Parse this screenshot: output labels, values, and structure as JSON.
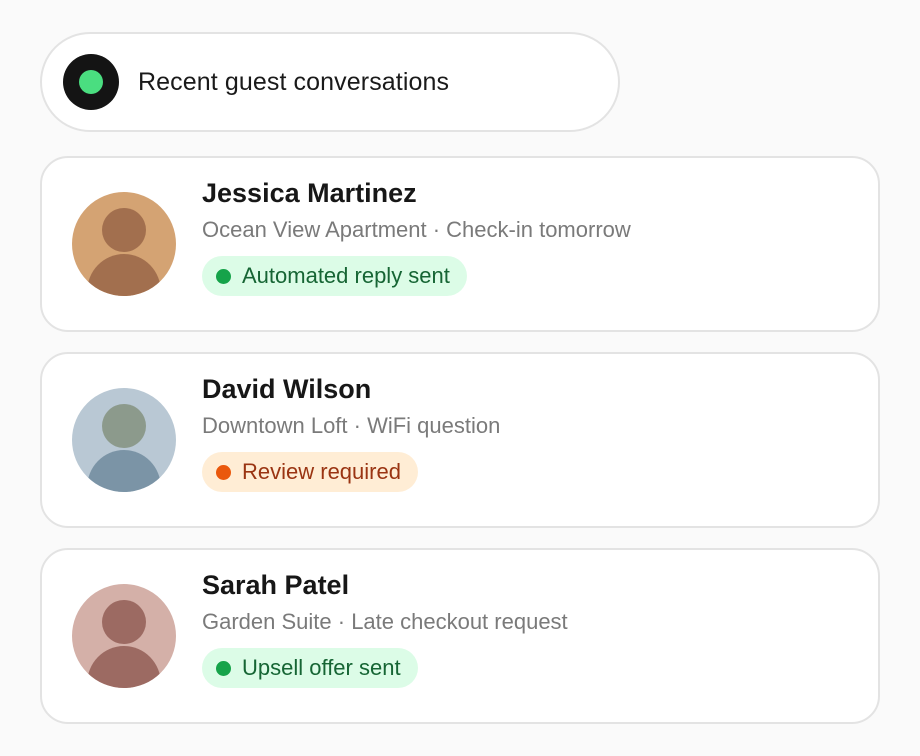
{
  "header": {
    "title": "Recent guest conversations",
    "indicator_color": "#4ade80"
  },
  "conversations": [
    {
      "name": "Jessica Martinez",
      "detail": "Ocean View Apartment · Check-in tomorrow",
      "status": "Automated reply sent",
      "status_type": "success",
      "avatar_colors": {
        "bg": "#d4a373",
        "fg": "#a26f4e"
      }
    },
    {
      "name": "David Wilson",
      "detail": "Downtown Loft · WiFi question",
      "status": "Review required",
      "status_type": "warning",
      "avatar_colors": {
        "bg": "#b9c8d4",
        "fg": "#7b94a6",
        "head": "#8c9a8c"
      }
    },
    {
      "name": "Sarah Patel",
      "detail": "Garden Suite · Late checkout request",
      "status": "Upsell offer sent",
      "status_type": "success",
      "avatar_colors": {
        "bg": "#d4b0a8",
        "fg": "#9c6a62"
      }
    }
  ]
}
